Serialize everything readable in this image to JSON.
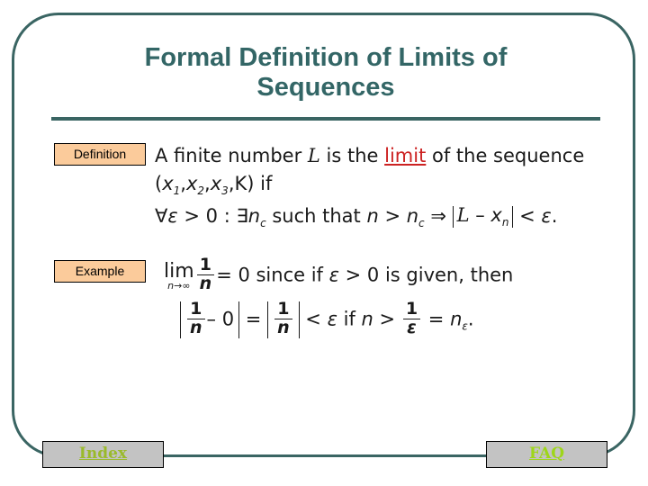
{
  "slide": {
    "title_line1": "Formal Definition of Limits of",
    "title_line2": "Sequences",
    "title_color": "#336666",
    "frame_color": "#3a6563",
    "background": "#ffffff"
  },
  "badges": {
    "definition_label": "Definition",
    "example_label": "Example",
    "badge_fill": "#fbcb9b",
    "badge_border": "#000000"
  },
  "definition": {
    "line1_pre": "A finite number ",
    "line1_var": "L",
    "line1_mid": " is the ",
    "line1_keyword": "limit",
    "line1_keyword_color": "#cc2222",
    "line1_post": " of the sequence",
    "line2_seq_open": "(",
    "line2_x1": "x",
    "line2_s1": "1",
    "line2_c1": ",",
    "line2_x2": "x",
    "line2_s2": "2",
    "line2_c2": ",",
    "line2_x3": "x",
    "line2_s3": "3",
    "line2_c3": ",",
    "line2_k": "K",
    "line2_seq_close": ") if",
    "line3_forall": "∀",
    "line3_eps": "ε",
    "line3_gt0": " > 0 : ",
    "line3_exists": "∃",
    "line3_n": "n",
    "line3_nsub": "c",
    "line3_such": " such that ",
    "line3_n2": "n",
    "line3_gt": " > ",
    "line3_n3": "n",
    "line3_n3sub": "c",
    "line3_implies": " ⇒ ",
    "line3_abs_L": "L",
    "line3_abs_minus": " – ",
    "line3_abs_x": "x",
    "line3_abs_xsub": "n",
    "line3_lt": " < ",
    "line3_eps2": "ε",
    "line3_period": "."
  },
  "example": {
    "lim_op": "lim",
    "lim_under_n": "n",
    "lim_under_arrow": "→",
    "lim_under_inf": "∞",
    "frac_num": "1",
    "frac_den": "n",
    "equals_zero": "= 0  since if ",
    "eps": "ε",
    "given": " > 0  is given, then",
    "f2_abs1_num": "1",
    "f2_abs1_den": "n",
    "f2_minus_zero": "– 0",
    "f2_equals": "=",
    "f2_abs2_num": "1",
    "f2_abs2_den": "n",
    "f2_lt": "<",
    "f2_eps": "ε",
    "f2_if": "if",
    "f2_n": "n",
    "f2_gt": ">",
    "f2_frac3_num": "1",
    "f2_frac3_den": "ε",
    "f2_eq2": "=",
    "f2_n_eps": "n",
    "f2_n_eps_sub": "ε",
    "f2_period": "."
  },
  "footer": {
    "index_label": "Index",
    "index_color": "#9aba2b",
    "faq_label": "FAQ",
    "faq_color": "#9ed619",
    "button_fill": "#c3c3c3"
  }
}
